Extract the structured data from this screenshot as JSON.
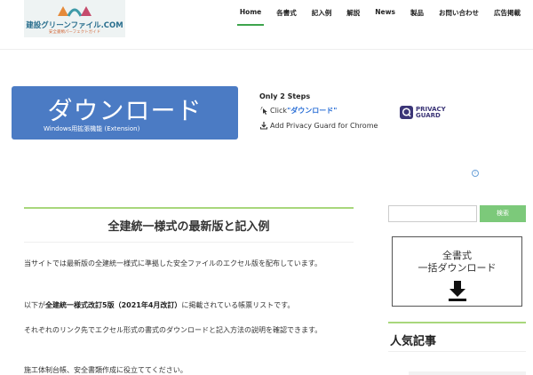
{
  "header": {
    "logo_title": "建設グリーンファイル.COM",
    "logo_subtitle": "安全書類パーフェクトガイド",
    "nav": [
      "Home",
      "各書式",
      "記入例",
      "解説",
      "News",
      "製品",
      "お問い合わせ",
      "広告掲載"
    ],
    "active_nav": "Home"
  },
  "ad": {
    "button_main": "ダウンロード",
    "button_sub": "Windows用拡張機能 (Extension)",
    "steps_title": "Only 2 Steps",
    "step1_prefix": "Click ",
    "step1_highlight": "\"ダウンロード\"",
    "step2": "Add Privacy Guard for Chrome",
    "brand_line1": "PRIVACY",
    "brand_line2": "GUARD",
    "info_icon": "i"
  },
  "article": {
    "title": "全建統一様式の最新版と記入例",
    "p1": "当サイトでは最新版の全建統一様式に準拠した安全ファイルのエクセル版を配布しています。",
    "p2_bold": "全建統一様式改訂5版（2021年4月改訂）",
    "p2_prefix": "以下が",
    "p2_suffix": "に掲載されている帳票リストです。",
    "p3": "それぞれのリンク先でエクセル形式の書式のダウンロードと記入方法の説明を確認できます。",
    "p4": "施工体制台帳、安全書類作成に役立ててください。"
  },
  "sidebar": {
    "search_placeholder": "",
    "search_button": "検索",
    "card_line1": "全書式",
    "card_line2": "一括ダウンロード",
    "popular_title": "人気記事"
  },
  "colors": {
    "accent_green": "#3ea44d",
    "button_blue": "#4b7bc4",
    "search_green": "#7cc97a"
  }
}
